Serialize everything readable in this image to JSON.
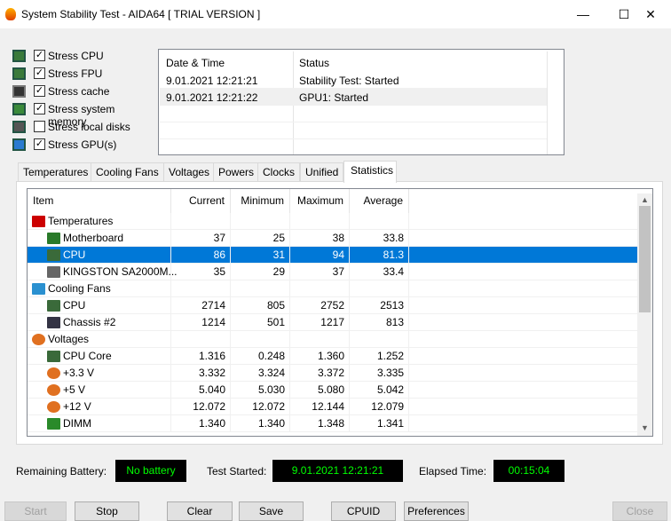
{
  "window": {
    "title": "System Stability Test - AIDA64  [ TRIAL VERSION ]",
    "minimize": "—",
    "maximize": "☐",
    "close": "✕"
  },
  "stress_options": [
    {
      "label": "Stress CPU",
      "checked": true,
      "icon": "cpu-icon",
      "color": "#3a7a3a"
    },
    {
      "label": "Stress FPU",
      "checked": true,
      "icon": "fpu-icon",
      "color": "#3a7a3a"
    },
    {
      "label": "Stress cache",
      "checked": true,
      "icon": "cache-chip-icon",
      "color": "#333333"
    },
    {
      "label": "Stress system memory",
      "checked": true,
      "icon": "memory-icon",
      "color": "#3a8a3a"
    },
    {
      "label": "Stress local disks",
      "checked": false,
      "icon": "disk-icon",
      "color": "#555555"
    },
    {
      "label": "Stress GPU(s)",
      "checked": true,
      "icon": "gpu-icon",
      "color": "#2a7ad0"
    }
  ],
  "log": {
    "headers": [
      "Date & Time",
      "Status"
    ],
    "rows": [
      [
        "9.01.2021 12:21:21",
        "Stability Test: Started"
      ],
      [
        "9.01.2021 12:21:22",
        "GPU1: Started"
      ]
    ]
  },
  "tabs": [
    "Temperatures",
    "Cooling Fans",
    "Voltages",
    "Powers",
    "Clocks",
    "Unified",
    "Statistics"
  ],
  "active_tab": "Statistics",
  "stats": {
    "headers": [
      "Item",
      "Current",
      "Minimum",
      "Maximum",
      "Average"
    ],
    "rows": [
      {
        "group": true,
        "item": "Temperatures",
        "icon": "thermometer-icon"
      },
      {
        "item": "Motherboard",
        "icon": "motherboard-icon",
        "v": [
          "37",
          "25",
          "38",
          "33.8"
        ]
      },
      {
        "item": "CPU",
        "icon": "cpu-icon",
        "v": [
          "86",
          "31",
          "94",
          "81.3"
        ],
        "selected": true
      },
      {
        "item": "KINGSTON SA2000M...",
        "icon": "disk-icon",
        "v": [
          "35",
          "29",
          "37",
          "33.4"
        ]
      },
      {
        "group": true,
        "item": "Cooling Fans",
        "icon": "fan-icon"
      },
      {
        "item": "CPU",
        "icon": "cpu-icon",
        "v": [
          "2714",
          "805",
          "2752",
          "2513"
        ]
      },
      {
        "item": "Chassis #2",
        "icon": "chassis-icon",
        "v": [
          "1214",
          "501",
          "1217",
          "813"
        ]
      },
      {
        "group": true,
        "item": "Voltages",
        "icon": "voltage-icon"
      },
      {
        "item": "CPU Core",
        "icon": "cpu-icon",
        "v": [
          "1.316",
          "0.248",
          "1.360",
          "1.252"
        ]
      },
      {
        "item": "+3.3 V",
        "icon": "voltage-icon",
        "v": [
          "3.332",
          "3.324",
          "3.372",
          "3.335"
        ]
      },
      {
        "item": "+5 V",
        "icon": "voltage-icon",
        "v": [
          "5.040",
          "5.030",
          "5.080",
          "5.042"
        ]
      },
      {
        "item": "+12 V",
        "icon": "voltage-icon",
        "v": [
          "12.072",
          "12.072",
          "12.144",
          "12.079"
        ]
      },
      {
        "item": "DIMM",
        "icon": "memory-icon",
        "v": [
          "1.340",
          "1.340",
          "1.348",
          "1.341"
        ]
      }
    ]
  },
  "status": {
    "battery_label": "Remaining Battery:",
    "battery_value": "No battery",
    "started_label": "Test Started:",
    "started_value": "9.01.2021 12:21:21",
    "elapsed_label": "Elapsed Time:",
    "elapsed_value": "00:15:04"
  },
  "buttons": {
    "start": "Start",
    "stop": "Stop",
    "clear": "Clear",
    "save": "Save",
    "cpuid": "CPUID",
    "preferences": "Preferences",
    "close": "Close"
  }
}
